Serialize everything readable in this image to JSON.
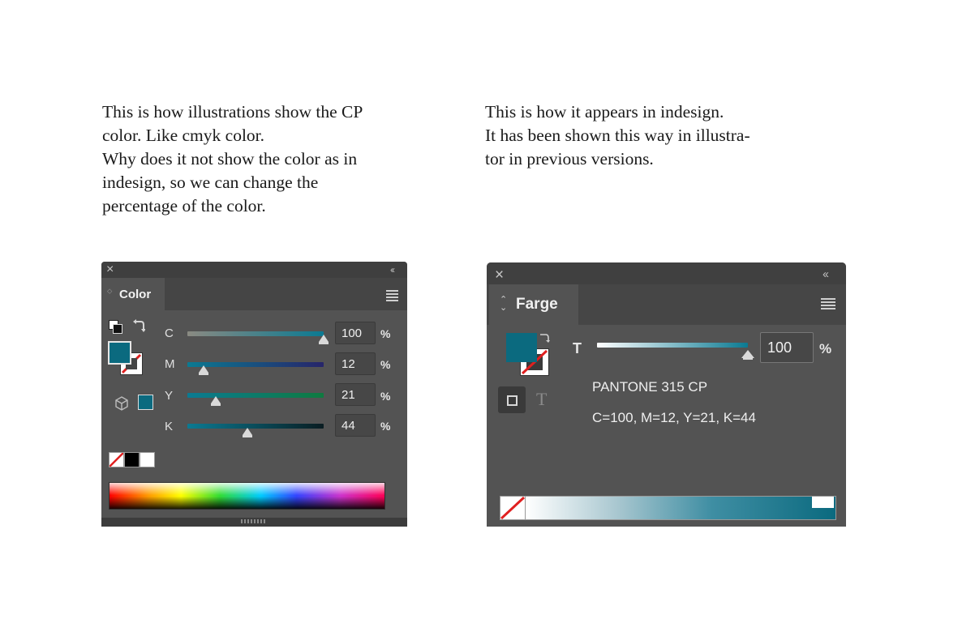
{
  "left_caption": {
    "lines": [
      "This is how illustrations show the CP",
      "color. Like cmyk color.",
      "Why does it not show the color as in",
      "indesign, so we can change the",
      "percentage of the color."
    ]
  },
  "right_caption": {
    "lines": [
      "This is how it appears in indesign.",
      "It has been shown this way in illustra-",
      "tor in previous versions."
    ]
  },
  "illustrator_panel": {
    "tab_label": "Color",
    "close_glyph": "×",
    "collapse_glyph": "‹‹",
    "accent_color": "#0b6a7f",
    "channels": [
      {
        "label": "C",
        "value": "100",
        "percent": 100,
        "unit": "%",
        "track_colors": [
          "#8a8a82",
          "#0b7a92"
        ]
      },
      {
        "label": "M",
        "value": "12",
        "percent": 12,
        "unit": "%",
        "track_colors": [
          "#0b7a92",
          "#27256a"
        ]
      },
      {
        "label": "Y",
        "value": "21",
        "percent": 21,
        "unit": "%",
        "track_colors": [
          "#0b7a92",
          "#0f7a40"
        ]
      },
      {
        "label": "K",
        "value": "44",
        "percent": 44,
        "unit": "%",
        "track_colors": [
          "#0b7a92",
          "#0a1d22"
        ]
      }
    ],
    "icons": [
      "default-fill-stroke-icon",
      "swap-fill-stroke-icon",
      "out-of-gamut-cube-icon",
      "menu-icon",
      "resize-grip-icon"
    ]
  },
  "indesign_panel": {
    "tab_label": "Farge",
    "tab_arrows": "⌃⌄",
    "close_glyph": "×",
    "collapse_glyph": "‹‹",
    "accent_color": "#0b6a7f",
    "tint_label": "T",
    "tint_value": "100",
    "tint_percent": 100,
    "tint_unit": "%",
    "swatch_name": "PANTONE 315 CP",
    "cmyk_breakdown": "C=100, M=12, Y=21, K=44",
    "text_icon_glyph": "T",
    "icons": [
      "swap-fill-stroke-icon",
      "formatting-container-icon",
      "formatting-text-icon",
      "menu-icon",
      "none-swatch-icon"
    ]
  }
}
